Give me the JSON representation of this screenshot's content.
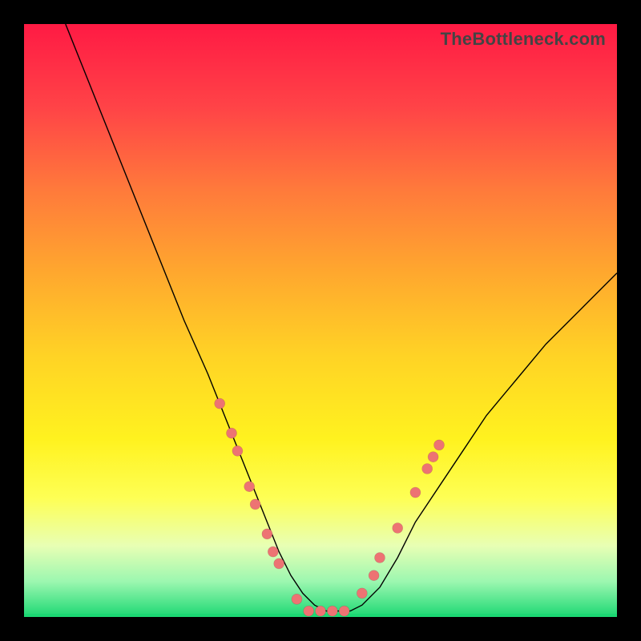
{
  "brand": {
    "watermark": "TheBottleneck.com"
  },
  "colors": {
    "gradient_top": "#ff1a44",
    "gradient_bottom": "#1cd873",
    "dot": "#ed7373",
    "curve": "#000000"
  },
  "chart_data": {
    "type": "line",
    "title": "",
    "xlabel": "",
    "ylabel": "",
    "xlim": [
      0,
      100
    ],
    "ylim": [
      0,
      100
    ],
    "grid": false,
    "series": [
      {
        "name": "bottleneck-curve",
        "x": [
          7,
          11,
          15,
          19,
          23,
          27,
          31,
          33,
          35,
          37,
          39,
          41,
          43,
          45,
          47,
          49,
          51,
          53,
          55,
          57,
          60,
          63,
          66,
          70,
          74,
          78,
          83,
          88,
          94,
          100
        ],
        "values": [
          100,
          90,
          80,
          70,
          60,
          50,
          41,
          36,
          31,
          26,
          21,
          16,
          11,
          7,
          4,
          2,
          1,
          1,
          1,
          2,
          5,
          10,
          16,
          22,
          28,
          34,
          40,
          46,
          52,
          58
        ]
      }
    ],
    "markers": [
      {
        "name": "cluster-left",
        "x": 33,
        "y": 36
      },
      {
        "name": "cluster-left",
        "x": 35,
        "y": 31
      },
      {
        "name": "cluster-left",
        "x": 36,
        "y": 28
      },
      {
        "name": "cluster-left",
        "x": 38,
        "y": 22
      },
      {
        "name": "cluster-left",
        "x": 39,
        "y": 19
      },
      {
        "name": "cluster-left",
        "x": 41,
        "y": 14
      },
      {
        "name": "cluster-left",
        "x": 42,
        "y": 11
      },
      {
        "name": "cluster-left",
        "x": 43,
        "y": 9
      },
      {
        "name": "floor",
        "x": 46,
        "y": 3
      },
      {
        "name": "floor",
        "x": 48,
        "y": 1
      },
      {
        "name": "floor",
        "x": 50,
        "y": 1
      },
      {
        "name": "floor",
        "x": 52,
        "y": 1
      },
      {
        "name": "floor",
        "x": 54,
        "y": 1
      },
      {
        "name": "cluster-right",
        "x": 57,
        "y": 4
      },
      {
        "name": "cluster-right",
        "x": 59,
        "y": 7
      },
      {
        "name": "cluster-right",
        "x": 60,
        "y": 10
      },
      {
        "name": "cluster-right",
        "x": 63,
        "y": 15
      },
      {
        "name": "cluster-right",
        "x": 66,
        "y": 21
      },
      {
        "name": "cluster-right",
        "x": 68,
        "y": 25
      },
      {
        "name": "cluster-right",
        "x": 69,
        "y": 27
      },
      {
        "name": "cluster-right",
        "x": 70,
        "y": 29
      }
    ]
  }
}
